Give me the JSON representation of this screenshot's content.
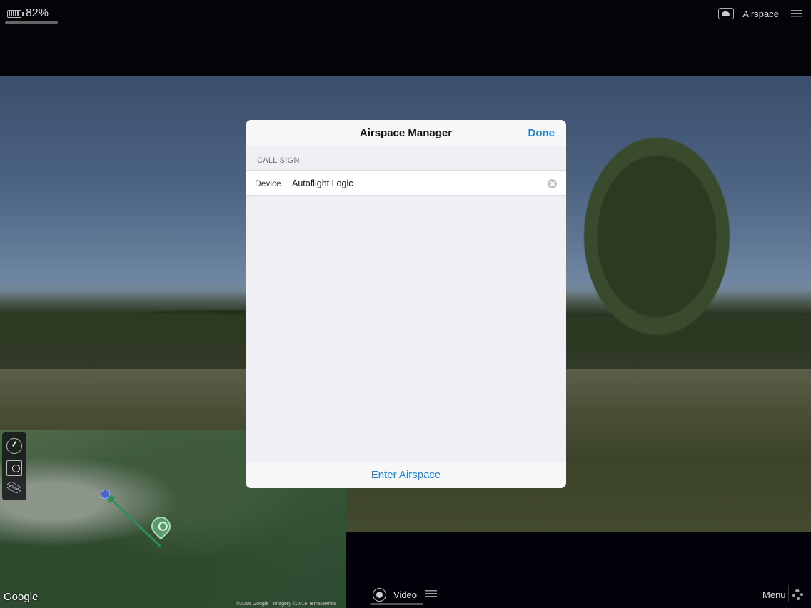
{
  "status": {
    "battery_percent": "82%",
    "airspace_label": "Airspace"
  },
  "dialog": {
    "title": "Airspace Manager",
    "done_label": "Done",
    "section_header": "CALL SIGN",
    "device_label": "Device",
    "device_value": "Autoflight Logic",
    "enter_label": "Enter Airspace"
  },
  "map": {
    "logo_text": "Google",
    "credit": "©2016 Google · Imagery ©2016 TerraMetrics"
  },
  "bottombar": {
    "video_label": "Video",
    "menu_label": "Menu"
  },
  "icons": [
    "battery-icon",
    "cloud-icon",
    "list-icon",
    "compass-icon",
    "map-search-icon",
    "layers-icon",
    "record-icon",
    "gear-icon",
    "clear-icon"
  ]
}
